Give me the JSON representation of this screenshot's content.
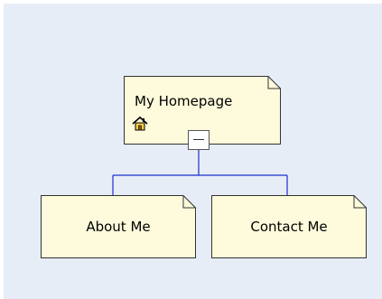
{
  "sitemap": {
    "root": {
      "label": "My Homepage",
      "icon": "home-icon",
      "expanded": true
    },
    "children": [
      {
        "label": "About Me"
      },
      {
        "label": "Contact Me"
      }
    ]
  },
  "colors": {
    "background": "#e6edf7",
    "node_fill": "#fdfbdb",
    "node_border": "#333333",
    "connector": "#1b2ecc"
  }
}
